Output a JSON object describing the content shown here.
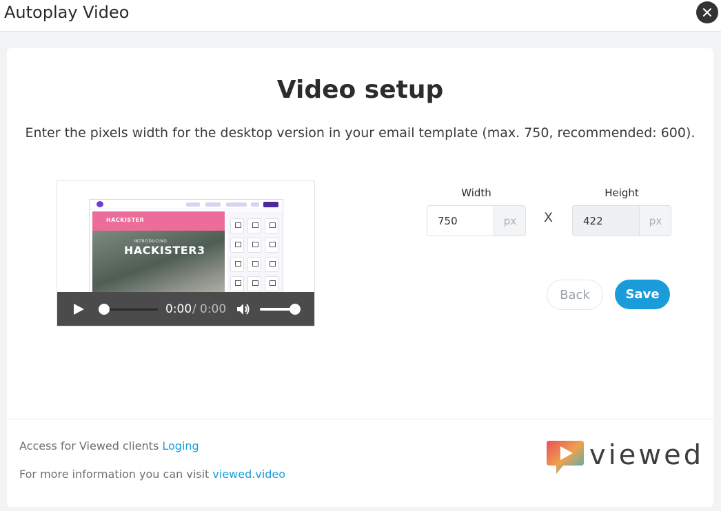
{
  "window": {
    "title": "Autoplay Video",
    "close_icon": "close-icon"
  },
  "setup": {
    "heading": "Video setup",
    "description": "Enter the pixels width for the desktop version in your email template (max. 750, recommended: 600)."
  },
  "video": {
    "thumbnail": {
      "brand": "HACKISTER",
      "intro": "INTRODUCING",
      "headline": "HACKISTER3"
    },
    "player": {
      "current_time": "0:00",
      "separator": "/",
      "duration": "0:00",
      "progress_fraction": 0,
      "volume_fraction": 1,
      "play_icon": "play-icon",
      "volume_icon": "volume-icon"
    }
  },
  "dimensions": {
    "width": {
      "label": "Width",
      "value": "750",
      "unit": "px"
    },
    "times": "X",
    "height": {
      "label": "Height",
      "value": "422",
      "unit": "px"
    }
  },
  "actions": {
    "back": "Back",
    "save": "Save"
  },
  "footer": {
    "access_text": "Access for Viewed clients",
    "access_link": "Loging",
    "info_text": "For more information you can visit",
    "info_link": "viewed.video"
  },
  "brand": {
    "logo_text": "viewed",
    "logo_mark": "viewed-logo-icon",
    "accent_color": "#1a9cdb"
  }
}
